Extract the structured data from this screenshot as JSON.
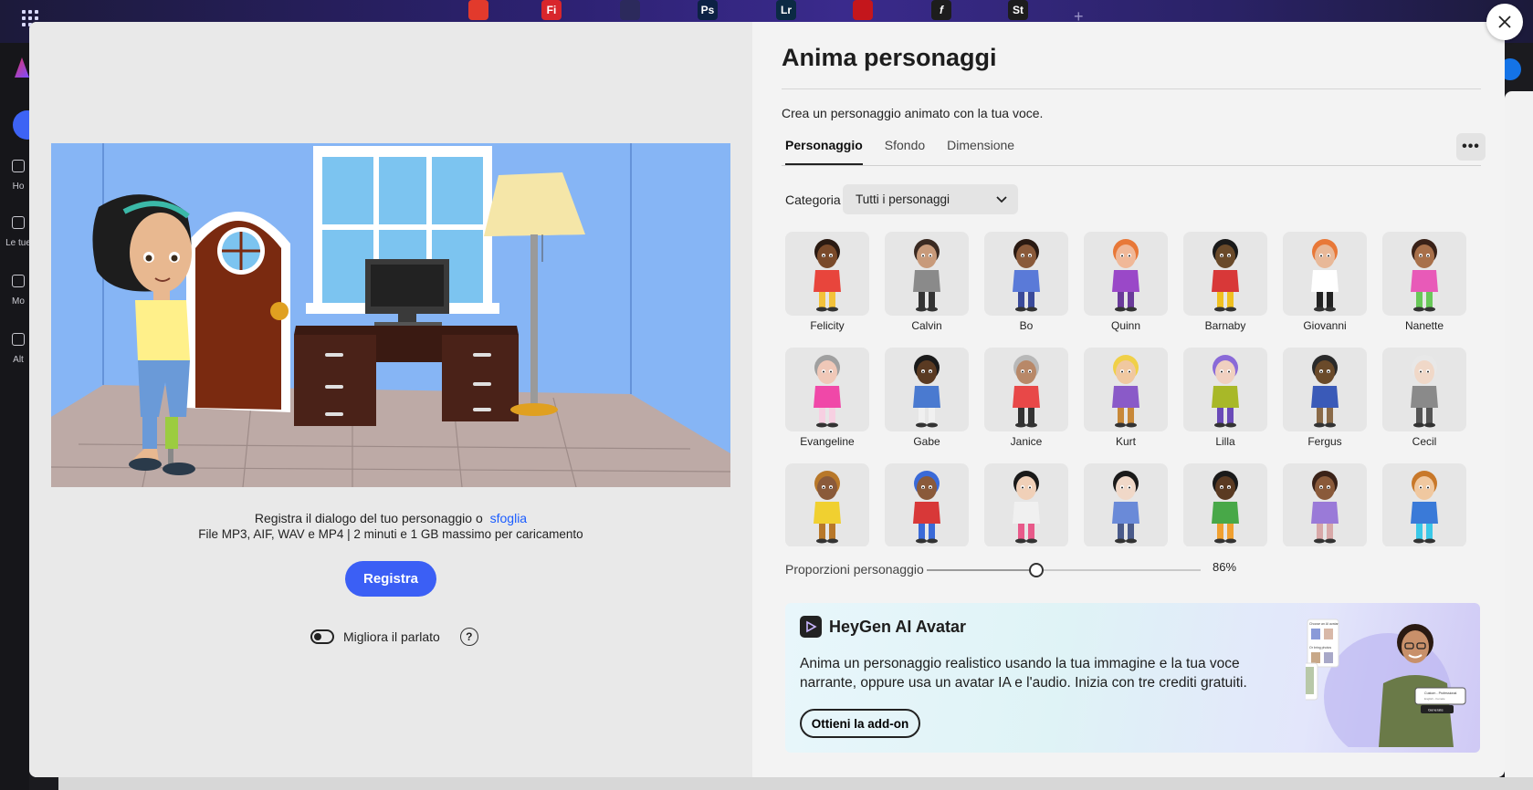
{
  "apps": [
    {
      "label": "",
      "color": "#e23a2c",
      "icon": "acrobat-icon"
    },
    {
      "label": "Fi",
      "color": "#d8262c",
      "icon": "fresco-icon"
    },
    {
      "label": "",
      "color": "#2c2a5c",
      "icon": "express-icon"
    },
    {
      "label": "Ps",
      "color": "#0c2144",
      "icon": "photoshop-icon"
    },
    {
      "label": "Lr",
      "color": "#0b2a44",
      "icon": "lightroom-icon"
    },
    {
      "label": "",
      "color": "#c4161c",
      "icon": "acrobat-pdf-icon"
    },
    {
      "label": "f",
      "color": "#1d1d1d",
      "icon": "fonts-icon"
    },
    {
      "label": "St",
      "color": "#1d1d1d",
      "icon": "stock-icon"
    }
  ],
  "rail": {
    "items": [
      {
        "label": "Ho",
        "icon": "home-icon"
      },
      {
        "label": "Le tue",
        "icon": "files-icon"
      },
      {
        "label": "Mo",
        "icon": "templates-icon"
      },
      {
        "label": "Alt",
        "icon": "more-icon"
      }
    ]
  },
  "left": {
    "record_prompt": "Registra il dialogo del tuo personaggio o",
    "browse_link": "sfoglia",
    "file_info": "File MP3, AIF, WAV e MP4 | 2 minuti e 1 GB massimo per caricamento",
    "record_button": "Registra",
    "enhance_label": "Migliora il parlato"
  },
  "panel": {
    "title": "Anima personaggi",
    "subtitle": "Crea un personaggio animato con la tua voce.",
    "tabs": [
      "Personaggio",
      "Sfondo",
      "Dimensione"
    ],
    "category_label": "Categoria",
    "category_value": "Tutti i personaggi",
    "characters": [
      {
        "name": "Felicity",
        "skin": "#7a4a2a",
        "hair": "#2a1a12",
        "shirt": "#e8453c",
        "accent": "#f3c23a"
      },
      {
        "name": "Calvin",
        "skin": "#c89a7a",
        "hair": "#3a2a22",
        "shirt": "#8a8a8a",
        "accent": "#333333"
      },
      {
        "name": "Bo",
        "skin": "#8a5a3a",
        "hair": "#2a1a12",
        "shirt": "#5a7ad8",
        "accent": "#3a4a9a"
      },
      {
        "name": "Quinn",
        "skin": "#f0b898",
        "hair": "#e87838",
        "shirt": "#9a48c8",
        "accent": "#6a3a9a"
      },
      {
        "name": "Barnaby",
        "skin": "#6a4a2a",
        "hair": "#1a1a1a",
        "shirt": "#d83838",
        "accent": "#f0c020"
      },
      {
        "name": "Giovanni",
        "skin": "#e8b898",
        "hair": "#e87838",
        "shirt": "#ffffff",
        "accent": "#222222"
      },
      {
        "name": "Nanette",
        "skin": "#a8704a",
        "hair": "#3a2218",
        "shirt": "#e85ab8",
        "accent": "#68c858"
      },
      {
        "name": "Evangeline",
        "skin": "#f0c8b8",
        "hair": "#a0a0a0",
        "shirt": "#f048a8",
        "accent": "#f7d0e2"
      },
      {
        "name": "Gabe",
        "skin": "#5a3a22",
        "hair": "#1a1a1a",
        "shirt": "#4a7ad0",
        "accent": "#f0f0f0"
      },
      {
        "name": "Janice",
        "skin": "#b88868",
        "hair": "#b8b8b8",
        "shirt": "#e84848",
        "accent": "#333333"
      },
      {
        "name": "Kurt",
        "skin": "#f0c8a0",
        "hair": "#f0d048",
        "shirt": "#8a5ac8",
        "accent": "#c88838"
      },
      {
        "name": "Lilla",
        "skin": "#f0d0c0",
        "hair": "#8a6ad8",
        "shirt": "#a8b828",
        "accent": "#6a4ab8"
      },
      {
        "name": "Fergus",
        "skin": "#6a4a2a",
        "hair": "#2a2a2a",
        "shirt": "#3a5ab8",
        "accent": "#8a6a48"
      },
      {
        "name": "Cecil",
        "skin": "#f0d8c8",
        "hair": "#e8e8e8",
        "shirt": "#8a8a8a",
        "accent": "#555555"
      },
      {
        "name": "",
        "skin": "#8a5a3a",
        "hair": "#b8782a",
        "shirt": "#f0d030",
        "accent": "#b8782a"
      },
      {
        "name": "",
        "skin": "#8a5a3a",
        "hair": "#3a6ad8",
        "shirt": "#d83838",
        "accent": "#3a6ad8"
      },
      {
        "name": "",
        "skin": "#f0d0b8",
        "hair": "#1a1a1a",
        "shirt": "#f0f0f0",
        "accent": "#e85a8a"
      },
      {
        "name": "",
        "skin": "#f0d8c8",
        "hair": "#1a1a1a",
        "shirt": "#6a8ad8",
        "accent": "#4a5a8a"
      },
      {
        "name": "",
        "skin": "#5a3a22",
        "hair": "#1a1a1a",
        "shirt": "#48a848",
        "accent": "#f0a030"
      },
      {
        "name": "",
        "skin": "#8a5a3a",
        "hair": "#3a2218",
        "shirt": "#9a7ad8",
        "accent": "#d8a8a8"
      },
      {
        "name": "",
        "skin": "#f0c8a0",
        "hair": "#c8782a",
        "shirt": "#3a7ad8",
        "accent": "#3ac8e8"
      }
    ],
    "proportion_label": "Proporzioni personaggio",
    "proportion_value": "86%",
    "proportion_level": 0.4,
    "promo": {
      "title": "HeyGen AI Avatar",
      "text": "Anima un personaggio realistico usando la tua immagine e la tua voce narrante, oppure usa un avatar IA e l'audio. Inizia con tre crediti gratuiti.",
      "button": "Ottieni la add-on",
      "art_texts": [
        "Choose an AI avatar",
        "Or bring photos",
        "Custom - Professional",
        "English - Female",
        "Generate"
      ]
    }
  }
}
